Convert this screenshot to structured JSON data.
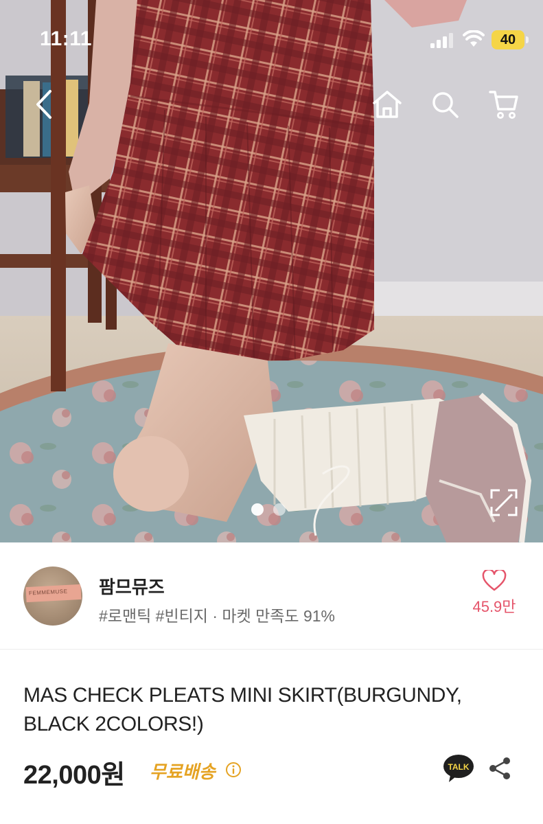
{
  "status_bar": {
    "time": "11:11",
    "battery": "40",
    "battery_color": "#f5d547"
  },
  "nav": {
    "icons": [
      "chevron-left-icon",
      "home-icon",
      "search-icon",
      "cart-icon"
    ]
  },
  "gallery": {
    "dot_count": 2,
    "active_index": 0
  },
  "shop": {
    "name": "팜므뮤즈",
    "tags": "#로맨틱 #빈티지 · 마켓 만족도 91%",
    "avatar_text": "FEMMEMUSE",
    "like_count": "45.9만",
    "accent_color": "#e5546a"
  },
  "product": {
    "title": "MAS CHECK PLEATS MINI SKIRT(BURGUNDY, BLACK 2COLORS!)",
    "price": "22,000원",
    "shipping": "무료배송",
    "shipping_color": "#e5a323",
    "talk_label": "TALK"
  }
}
